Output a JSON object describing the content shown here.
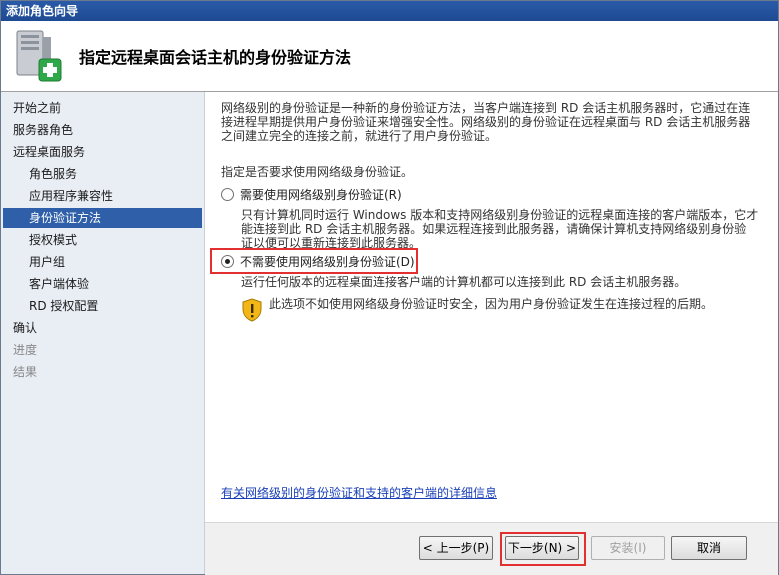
{
  "window": {
    "title": "添加角色向导"
  },
  "header": {
    "title": "指定远程桌面会话主机的身份验证方法"
  },
  "sidebar": {
    "items": [
      {
        "label": "开始之前",
        "state": "normal",
        "level": 0
      },
      {
        "label": "服务器角色",
        "state": "normal",
        "level": 0
      },
      {
        "label": "远程桌面服务",
        "state": "normal",
        "level": 0
      },
      {
        "label": "角色服务",
        "state": "normal",
        "level": 1
      },
      {
        "label": "应用程序兼容性",
        "state": "normal",
        "level": 1
      },
      {
        "label": "身份验证方法",
        "state": "selected",
        "level": 1
      },
      {
        "label": "授权模式",
        "state": "normal",
        "level": 1
      },
      {
        "label": "用户组",
        "state": "normal",
        "level": 1
      },
      {
        "label": "客户端体验",
        "state": "normal",
        "level": 1
      },
      {
        "label": "RD 授权配置",
        "state": "normal",
        "level": 1
      },
      {
        "label": "确认",
        "state": "normal",
        "level": 0
      },
      {
        "label": "进度",
        "state": "disabled",
        "level": 0
      },
      {
        "label": "结果",
        "state": "disabled",
        "level": 0
      }
    ]
  },
  "main": {
    "description_line1": "网络级别的身份验证是一种新的身份验证方法，当客户端连接到 RD 会话主机服务器时，它通过在连",
    "description_line2": "接进程早期提供用户身份验证来增强安全性。网络级别的身份验证在远程桌面与 RD 会话主机服务器",
    "description_line3": "之间建立完全的连接之前，就进行了用户身份验证。",
    "prompt": "指定是否要求使用网络级身份验证。",
    "option_require": {
      "label": "需要使用网络级别身份验证(R)",
      "selected": false,
      "desc_line1": "只有计算机同时运行 Windows 版本和支持网络级别身份验证的远程桌面连接的客户端版本，它才",
      "desc_line2": "能连接到此 RD 会话主机服务器。如果远程连接到此服务器，请确保计算机支持网络级别身份验",
      "desc_line3": "证以便可以重新连接到此服务器。"
    },
    "option_not_require": {
      "label": "不需要使用网络级别身份验证(D)",
      "selected": true,
      "desc": "运行任何版本的远程桌面连接客户端的计算机都可以连接到此 RD 会话主机服务器。"
    },
    "warning": {
      "icon": "shield-warning-icon",
      "text": "此选项不如使用网络级身份验证时安全，因为用户身份验证发生在连接过程的后期。"
    },
    "help_link": "有关网络级别的身份验证和支持的客户端的详细信息"
  },
  "footer": {
    "back_label": "< 上一步(P)",
    "next_label": "下一步(N) >",
    "install_label": "安装(I)",
    "cancel_label": "取消"
  },
  "colors": {
    "titlebar": "#1e4a92",
    "sidebar_bg": "#e9eef5",
    "selected": "#2e5fa8",
    "highlight": "#e23030",
    "link": "#1a3fb8"
  }
}
